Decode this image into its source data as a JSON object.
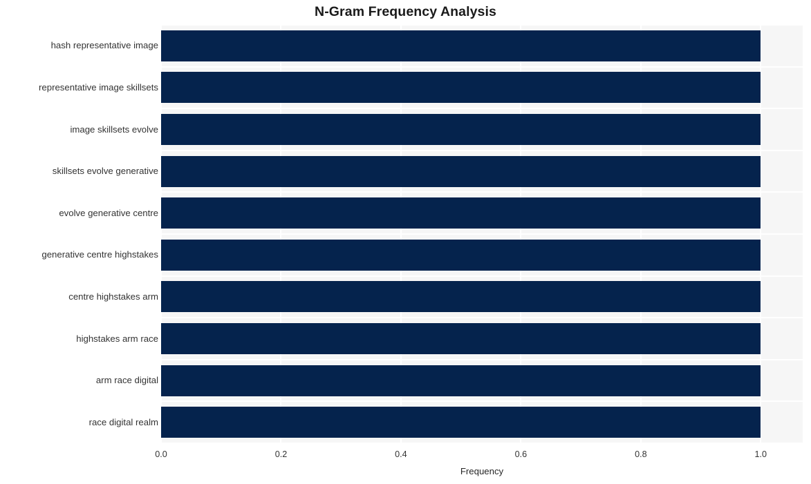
{
  "chart_data": {
    "type": "bar",
    "orientation": "horizontal",
    "title": "N-Gram Frequency Analysis",
    "xlabel": "Frequency",
    "ylabel": "",
    "categories": [
      "hash representative image",
      "representative image skillsets",
      "image skillsets evolve",
      "skillsets evolve generative",
      "evolve generative centre",
      "generative centre highstakes",
      "centre highstakes arm",
      "highstakes arm race",
      "arm race digital",
      "race digital realm"
    ],
    "values": [
      1.0,
      1.0,
      1.0,
      1.0,
      1.0,
      1.0,
      1.0,
      1.0,
      1.0,
      1.0
    ],
    "xlim": [
      0.0,
      1.07
    ],
    "xticks": [
      "0.0",
      "0.2",
      "0.4",
      "0.6",
      "0.8",
      "1.0"
    ],
    "xtick_values": [
      0.0,
      0.2,
      0.4,
      0.6,
      0.8,
      1.0
    ],
    "grid": true,
    "legend": "none",
    "bar_color": "#05234d",
    "plot_background": "#f6f6f6",
    "grid_color": "#ffffff",
    "figure_background": "#ffffff"
  }
}
